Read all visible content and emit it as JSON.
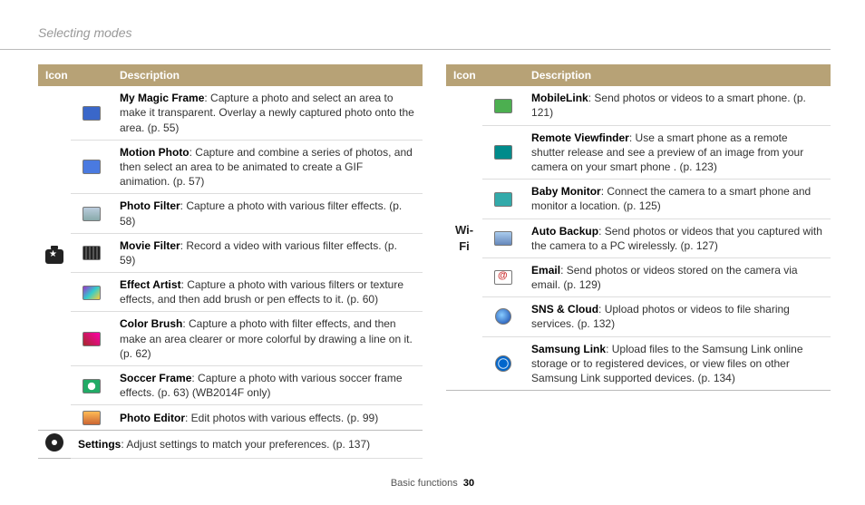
{
  "page_title": "Selecting modes",
  "footer": {
    "section": "Basic functions",
    "page": "30"
  },
  "headers": {
    "icon": "Icon",
    "description": "Description"
  },
  "left": {
    "group1_icon": "camera-star",
    "rows": [
      {
        "bold": "My Magic Frame",
        "text": ": Capture a photo and select an area to make it transparent. Overlay a newly captured photo onto the area. (p. 55)",
        "icon": "ic-blue"
      },
      {
        "bold": "Motion Photo",
        "text": ": Capture and combine a series of photos, and then select an area to be animated to create a GIF animation. (p. 57)",
        "icon": "ic-blue2"
      },
      {
        "bold": "Photo Filter",
        "text": ": Capture a photo with various filter effects. (p. 58)",
        "icon": "ic-photo"
      },
      {
        "bold": "Movie Filter",
        "text": ": Record a video with various filter effects. (p. 59)",
        "icon": "ic-film"
      },
      {
        "bold": "Effect Artist",
        "text": ": Capture a photo with various filters or texture effects, and then add brush or pen effects to it. (p. 60)",
        "icon": "ic-art"
      },
      {
        "bold": "Color Brush",
        "text": ": Capture a photo with filter effects, and then make an area clearer or more colorful by drawing a line on it. (p. 62)",
        "icon": "ic-brush"
      },
      {
        "bold": "Soccer Frame",
        "text": ":  Capture a photo with various soccer frame effects. (p. 63) (WB2014F only)",
        "icon": "ic-soccer"
      },
      {
        "bold": "Photo Editor",
        "text": ": Edit photos with various effects. (p. 99)",
        "icon": "ic-edit"
      }
    ],
    "settings": {
      "bold": "Settings",
      "text": ": Adjust settings to match your preferences. (p. 137)"
    }
  },
  "right": {
    "group_label": "Wi-Fi",
    "rows": [
      {
        "bold": "MobileLink",
        "text": ": Send photos or videos to a smart phone. (p. 121)",
        "icon": "ic-green"
      },
      {
        "bold": "Remote Viewfinder",
        "text": ": Use a smart phone as a remote shutter release and see a preview of an image from your camera on your smart phone . (p. 123)",
        "icon": "ic-teal"
      },
      {
        "bold": "Baby Monitor",
        "text": ": Connect the camera to a smart phone and monitor a location. (p. 125)",
        "icon": "ic-babym"
      },
      {
        "bold": "Auto Backup",
        "text": ": Send photos or videos that you captured with the camera to a PC wirelessly. (p. 127)",
        "icon": "ic-backup"
      },
      {
        "bold": "Email",
        "text": ": Send photos or videos stored on the camera via email. (p. 129)",
        "icon": "ic-email"
      },
      {
        "bold": "SNS & Cloud",
        "text": ": Upload photos or videos to file sharing services. (p. 132)",
        "icon": "ic-globe"
      },
      {
        "bold": "Samsung Link",
        "text": ": Upload files to the Samsung Link online storage or to registered devices, or view files on other Samsung Link supported devices.  (p. 134)",
        "icon": "ic-slink"
      }
    ]
  }
}
